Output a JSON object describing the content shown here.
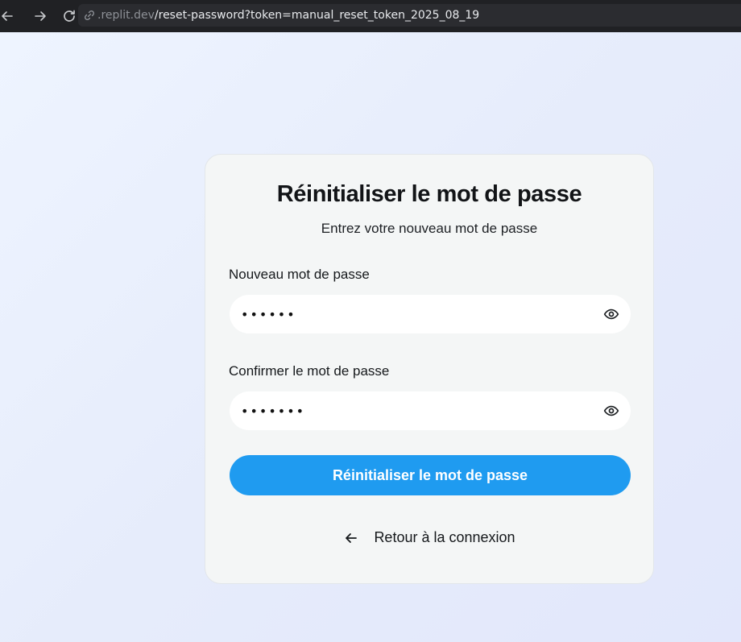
{
  "browser": {
    "back_icon": "arrow-left-icon",
    "forward_icon": "arrow-right-icon",
    "reload_icon": "reload-icon",
    "url_host": ".replit.dev",
    "url_path": "/reset-password?token=manual_reset_token_2025_08_19"
  },
  "card": {
    "title": "Réinitialiser le mot de passe",
    "subtitle": "Entrez votre nouveau mot de passe",
    "new_password": {
      "label": "Nouveau mot de passe",
      "value": "abcdef",
      "toggle_icon": "eye-icon"
    },
    "confirm_password": {
      "label": "Confirmer le mot de passe",
      "value": "abcdefg",
      "toggle_icon": "eye-icon"
    },
    "submit_label": "Réinitialiser le mot de passe",
    "back_label": "Retour à la connexion",
    "back_icon": "arrow-left-icon"
  },
  "colors": {
    "accent": "#1f9bf0",
    "card_bg": "#f4f6f6",
    "page_bg": "#e6ecfb"
  }
}
